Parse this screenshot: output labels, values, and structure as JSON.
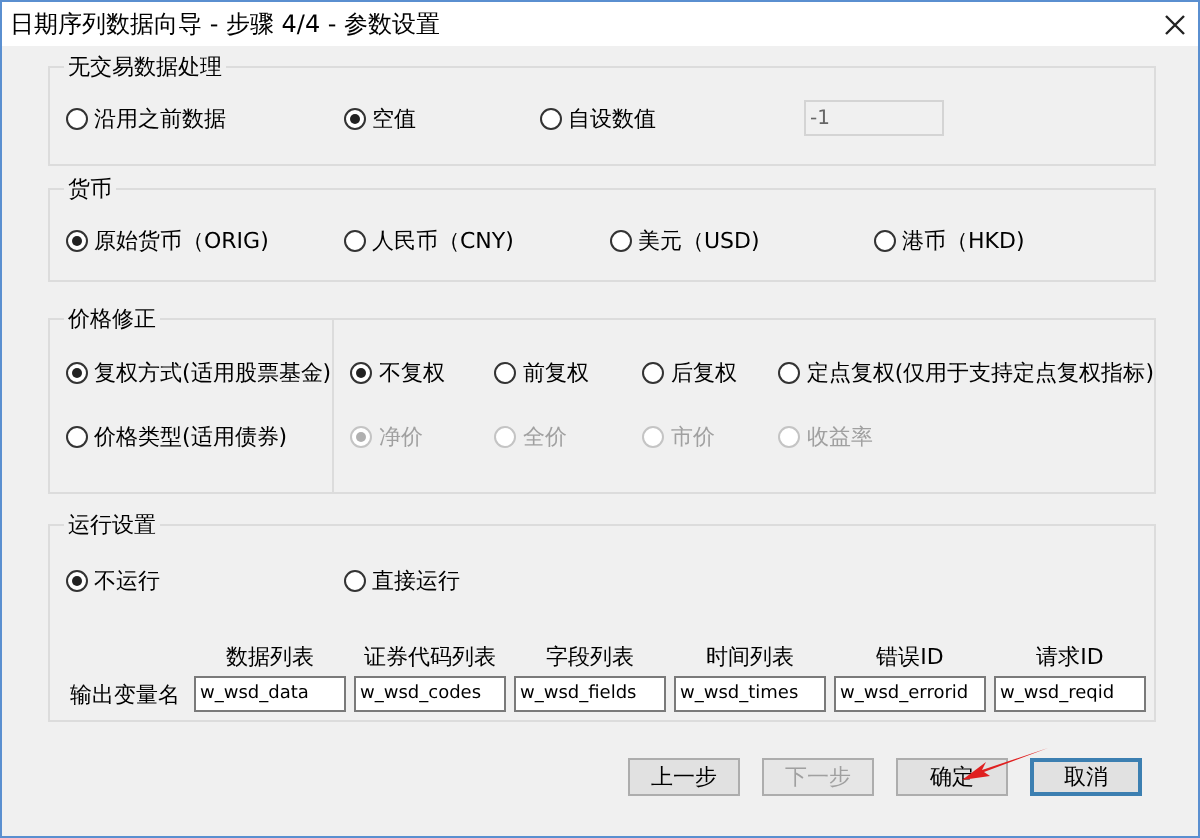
{
  "window": {
    "title": "日期序列数据向导 - 步骤 4/4 - 参数设置"
  },
  "no_trade": {
    "title": "无交易数据处理",
    "options": [
      {
        "label": "沿用之前数据",
        "selected": false
      },
      {
        "label": "空值",
        "selected": true
      },
      {
        "label": "自设数值",
        "selected": false
      }
    ],
    "custom_value": {
      "value": "-1",
      "disabled": true
    }
  },
  "currency": {
    "title": "货币",
    "options": [
      {
        "label": "原始货币（ORIG)",
        "selected": true
      },
      {
        "label": "人民币（CNY)",
        "selected": false
      },
      {
        "label": "美元（USD)",
        "selected": false
      },
      {
        "label": "港币（HKD)",
        "selected": false
      }
    ]
  },
  "price_adjust": {
    "title": "价格修正",
    "modes": [
      {
        "label": "复权方式(适用股票基金)",
        "selected": true
      },
      {
        "label": "价格类型(适用债券)",
        "selected": false
      }
    ],
    "adjust_options": [
      {
        "label": "不复权",
        "selected": true,
        "disabled": false
      },
      {
        "label": "前复权",
        "selected": false,
        "disabled": false
      },
      {
        "label": "后复权",
        "selected": false,
        "disabled": false
      },
      {
        "label": "定点复权(仅用于支持定点复权指标)",
        "selected": false,
        "disabled": false
      }
    ],
    "price_types": [
      {
        "label": "净价",
        "selected": true,
        "disabled": true
      },
      {
        "label": "全价",
        "selected": false,
        "disabled": true
      },
      {
        "label": "市价",
        "selected": false,
        "disabled": true
      },
      {
        "label": "收益率",
        "selected": false,
        "disabled": true
      }
    ]
  },
  "run": {
    "title": "运行设置",
    "options": [
      {
        "label": "不运行",
        "selected": true
      },
      {
        "label": "直接运行",
        "selected": false
      }
    ],
    "output_label": "输出变量名",
    "outputs": [
      {
        "label": "数据列表",
        "value": "w_wsd_data"
      },
      {
        "label": "证券代码列表",
        "value": "w_wsd_codes"
      },
      {
        "label": "字段列表",
        "value": "w_wsd_fields"
      },
      {
        "label": "时间列表",
        "value": "w_wsd_times"
      },
      {
        "label": "错误ID",
        "value": "w_wsd_errorid"
      },
      {
        "label": "请求ID",
        "value": "w_wsd_reqid"
      }
    ]
  },
  "buttons": [
    {
      "label": "上一步",
      "disabled": false,
      "default": false
    },
    {
      "label": "下一步",
      "disabled": true,
      "default": false
    },
    {
      "label": "确定",
      "disabled": false,
      "default": false
    },
    {
      "label": "取消",
      "disabled": false,
      "default": true
    }
  ]
}
